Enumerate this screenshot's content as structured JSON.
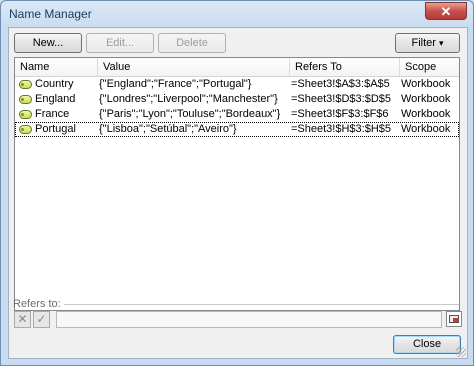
{
  "window": {
    "title": "Name Manager",
    "close_label": "✕"
  },
  "toolbar": {
    "new_label": "New...",
    "edit_label": "Edit...",
    "delete_label": "Delete",
    "filter_label": "Filter",
    "filter_arrow": "▾"
  },
  "table": {
    "columns": [
      "Name",
      "Value",
      "Refers To",
      "Scope"
    ],
    "rows": [
      {
        "name": "Country",
        "value": "{\"England\";\"France\";\"Portugal\"}",
        "refers_to": "=Sheet3!$A$3:$A$5",
        "scope": "Workbook"
      },
      {
        "name": "England",
        "value": "{\"Londres\";\"Liverpool\";\"Manchester\"}",
        "refers_to": "=Sheet3!$D$3:$D$5",
        "scope": "Workbook"
      },
      {
        "name": "France",
        "value": "{\"Paris\";\"Lyon\";\"Touluse\";\"Bordeaux\"}",
        "refers_to": "=Sheet3!$F$3:$F$6",
        "scope": "Workbook"
      },
      {
        "name": "Portugal",
        "value": "{\"Lisboa\";\"Setúbal\";\"Aveiro\"}",
        "refers_to": "=Sheet3!$H$3:$H$5",
        "scope": "Workbook"
      }
    ],
    "selected_row": 3
  },
  "refers": {
    "label": "Refers to:",
    "value": "",
    "cancel_icon": "✕",
    "confirm_icon": "✓"
  },
  "footer": {
    "close_label": "Close"
  },
  "colors": {
    "title_text": "#1e395b",
    "close_button": "#c75050",
    "name_tag": "#d2dd58"
  }
}
